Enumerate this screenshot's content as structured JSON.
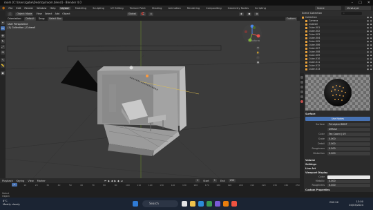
{
  "window": {
    "title": "room [C:\\Users\\gabe\\Desktop\\room.blend] - Blender 4.0"
  },
  "menus": [
    "File",
    "Edit",
    "Render",
    "Window",
    "Help"
  ],
  "workspaces": [
    {
      "label": "Layout",
      "active": true
    },
    {
      "label": "Modeling"
    },
    {
      "label": "Sculpting"
    },
    {
      "label": "UV Editing"
    },
    {
      "label": "Texture Paint"
    },
    {
      "label": "Shading"
    },
    {
      "label": "Animation"
    },
    {
      "label": "Rendering"
    },
    {
      "label": "Compositing"
    },
    {
      "label": "Geometry Nodes"
    },
    {
      "label": "Scripting"
    }
  ],
  "scene": {
    "scene_name": "Scene",
    "view_layer": "ViewLayer"
  },
  "viewport_header": {
    "mode": "Object Mode",
    "view": "View",
    "select": "Select",
    "add": "Add",
    "object": "Object",
    "orientation": "Global",
    "options": "Options"
  },
  "viewport_header2": {
    "orientation_label": "Orientation:",
    "orientation": "Default",
    "drag_label": "Drag:",
    "drag": "Select Box"
  },
  "viewport_info": {
    "line1": "User Perspective",
    "line2": "(1) Collection | Cubeall"
  },
  "transform_label": "Transform",
  "toolbar_icons": [
    "cursor",
    "move",
    "rotate",
    "scale",
    "transform",
    "annotate",
    "measure",
    "add-cube"
  ],
  "timeline": {
    "playback": "Playback",
    "keying": "Keying",
    "view": "View",
    "marker": "Marker",
    "current_frame": "1",
    "start_label": "Start",
    "start": "1",
    "end_label": "End",
    "end": "250",
    "ticks": [
      "0",
      "10",
      "20",
      "30",
      "40",
      "50",
      "60",
      "70",
      "80",
      "90",
      "100",
      "110",
      "120",
      "130",
      "140",
      "150",
      "160",
      "170",
      "180",
      "190",
      "200",
      "210",
      "220",
      "230",
      "240",
      "250"
    ]
  },
  "status": {
    "left": "Select",
    "middle": "Rotate View",
    "right": "Object"
  },
  "outliner": {
    "title": "Scene Collection",
    "search_placeholder": "",
    "items": [
      {
        "label": "Collection"
      },
      {
        "label": "Camera"
      },
      {
        "label": "Cubeall"
      },
      {
        "label": "Cube.001"
      },
      {
        "label": "Cube.002"
      },
      {
        "label": "Cube.003"
      },
      {
        "label": "Cube.004"
      },
      {
        "label": "Cube.005"
      },
      {
        "label": "Cube.006"
      },
      {
        "label": "Cube.007"
      },
      {
        "label": "Cube.008"
      },
      {
        "label": "Cube.009"
      },
      {
        "label": "Cube.010"
      },
      {
        "label": "Cube.011"
      },
      {
        "label": "Cube.012"
      },
      {
        "label": "Cube.013"
      }
    ]
  },
  "properties": {
    "surface_header": "Surface",
    "use_nodes": "Use Nodes",
    "rows": [
      {
        "label": "Surface",
        "value": "Principled BSDF"
      },
      {
        "label": "",
        "value": "Diffuse"
      },
      {
        "label": "Color",
        "value": "Tex Coord | UV"
      },
      {
        "label": "Scale",
        "value": "5.000"
      },
      {
        "label": "Detail",
        "value": "2.000"
      },
      {
        "label": "Roughness",
        "value": "0.500"
      },
      {
        "label": "Distortion",
        "value": "0.000"
      }
    ],
    "volume": "Volume",
    "settings": "Settings",
    "lineart": "Line Art",
    "viewport_display": "Viewport Display",
    "vd_rows": [
      {
        "label": "Color",
        "value": ""
      },
      {
        "label": "Metallic",
        "value": "0.000"
      },
      {
        "label": "Roughness",
        "value": "0.400"
      }
    ],
    "custom_props": "Custom Properties"
  },
  "taskbar": {
    "weather_temp": "8°C",
    "weather_desc": "Mostly cloudy",
    "search": "Search",
    "time": "13:00",
    "date": "04/03/2024",
    "lang": "ENG UK"
  }
}
